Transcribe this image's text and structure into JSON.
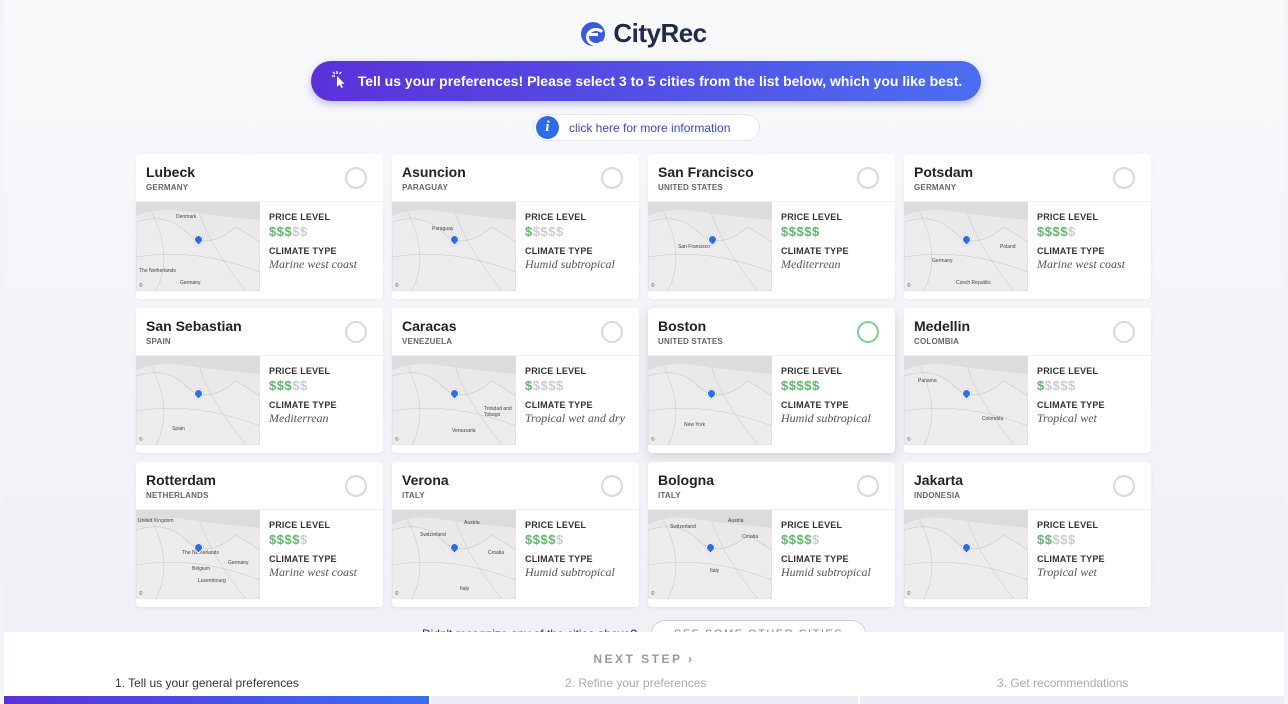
{
  "app": {
    "name": "CityRec"
  },
  "banner": {
    "text": "Tell us your preferences! Please select 3 to 5 cities from the list below, which you like best."
  },
  "info": {
    "text": "click here for more information"
  },
  "labels": {
    "price": "PRICE LEVEL",
    "climate": "CLIMATE TYPE"
  },
  "colors": {
    "accent": "#5b31d9",
    "accent2": "#4b6ef0",
    "price_on": "#5cb96a",
    "price_off": "#c9ccd2",
    "selected": "#7ccf92"
  },
  "cities": [
    {
      "name": "Lubeck",
      "country": "GERMANY",
      "price": 3,
      "climate": "Marine west coast",
      "selected": false,
      "map_labels": [
        "Denmark",
        "The Netherlands",
        "Germany"
      ]
    },
    {
      "name": "Asuncion",
      "country": "PARAGUAY",
      "price": 1,
      "climate": "Humid subtropical",
      "selected": false,
      "map_labels": [
        "Paraguay"
      ]
    },
    {
      "name": "San Francisco",
      "country": "UNITED STATES",
      "price": 5,
      "climate": "Mediterrean",
      "selected": false,
      "map_labels": [
        "San Francisco"
      ]
    },
    {
      "name": "Potsdam",
      "country": "GERMANY",
      "price": 4,
      "climate": "Marine west coast",
      "selected": false,
      "map_labels": [
        "Poland",
        "Germany",
        "Czech Republic"
      ]
    },
    {
      "name": "San Sebastian",
      "country": "SPAIN",
      "price": 3,
      "climate": "Mediterrean",
      "selected": false,
      "map_labels": [
        "Spain"
      ]
    },
    {
      "name": "Caracas",
      "country": "VENEZUELA",
      "price": 1,
      "climate": "Tropical wet and dry",
      "selected": false,
      "map_labels": [
        "Venezuela",
        "Trinidad and Tobago"
      ]
    },
    {
      "name": "Boston",
      "country": "UNITED STATES",
      "price": 5,
      "climate": "Humid subtropical",
      "selected": true,
      "map_labels": [
        "New York"
      ]
    },
    {
      "name": "Medellin",
      "country": "COLOMBIA",
      "price": 1,
      "climate": "Tropical wet",
      "selected": false,
      "map_labels": [
        "Panama",
        "Colombia"
      ]
    },
    {
      "name": "Rotterdam",
      "country": "NETHERLANDS",
      "price": 4,
      "climate": "Marine west coast",
      "selected": false,
      "map_labels": [
        "United Kingdom",
        "The Netherlands",
        "Germany",
        "Belgium",
        "Luxembourg"
      ]
    },
    {
      "name": "Verona",
      "country": "ITALY",
      "price": 4,
      "climate": "Humid subtropical",
      "selected": false,
      "map_labels": [
        "Switzerland",
        "Austria",
        "Croatia",
        "Italy"
      ]
    },
    {
      "name": "Bologna",
      "country": "ITALY",
      "price": 4,
      "climate": "Humid subtropical",
      "selected": false,
      "map_labels": [
        "Switzerland",
        "Austria",
        "Croatia",
        "Italy"
      ]
    },
    {
      "name": "Jakarta",
      "country": "INDONESIA",
      "price": 2,
      "climate": "Tropical wet",
      "selected": false,
      "map_labels": []
    }
  ],
  "other": {
    "question": "Didn't recognize any of the cities above?",
    "button": "SEE SOME OTHER CITIES"
  },
  "footer": {
    "next": "NEXT STEP ›",
    "steps": [
      "1. Tell us your general preferences",
      "2. Refine your preferences",
      "3. Get recommendations"
    ]
  }
}
